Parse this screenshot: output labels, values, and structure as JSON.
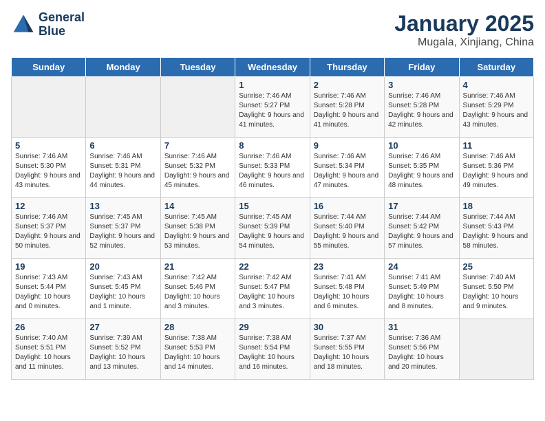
{
  "header": {
    "logo_line1": "General",
    "logo_line2": "Blue",
    "title": "January 2025",
    "subtitle": "Mugala, Xinjiang, China"
  },
  "weekdays": [
    "Sunday",
    "Monday",
    "Tuesday",
    "Wednesday",
    "Thursday",
    "Friday",
    "Saturday"
  ],
  "weeks": [
    [
      {
        "num": "",
        "info": ""
      },
      {
        "num": "",
        "info": ""
      },
      {
        "num": "",
        "info": ""
      },
      {
        "num": "1",
        "info": "Sunrise: 7:46 AM\nSunset: 5:27 PM\nDaylight: 9 hours and 41 minutes."
      },
      {
        "num": "2",
        "info": "Sunrise: 7:46 AM\nSunset: 5:28 PM\nDaylight: 9 hours and 41 minutes."
      },
      {
        "num": "3",
        "info": "Sunrise: 7:46 AM\nSunset: 5:28 PM\nDaylight: 9 hours and 42 minutes."
      },
      {
        "num": "4",
        "info": "Sunrise: 7:46 AM\nSunset: 5:29 PM\nDaylight: 9 hours and 43 minutes."
      }
    ],
    [
      {
        "num": "5",
        "info": "Sunrise: 7:46 AM\nSunset: 5:30 PM\nDaylight: 9 hours and 43 minutes."
      },
      {
        "num": "6",
        "info": "Sunrise: 7:46 AM\nSunset: 5:31 PM\nDaylight: 9 hours and 44 minutes."
      },
      {
        "num": "7",
        "info": "Sunrise: 7:46 AM\nSunset: 5:32 PM\nDaylight: 9 hours and 45 minutes."
      },
      {
        "num": "8",
        "info": "Sunrise: 7:46 AM\nSunset: 5:33 PM\nDaylight: 9 hours and 46 minutes."
      },
      {
        "num": "9",
        "info": "Sunrise: 7:46 AM\nSunset: 5:34 PM\nDaylight: 9 hours and 47 minutes."
      },
      {
        "num": "10",
        "info": "Sunrise: 7:46 AM\nSunset: 5:35 PM\nDaylight: 9 hours and 48 minutes."
      },
      {
        "num": "11",
        "info": "Sunrise: 7:46 AM\nSunset: 5:36 PM\nDaylight: 9 hours and 49 minutes."
      }
    ],
    [
      {
        "num": "12",
        "info": "Sunrise: 7:46 AM\nSunset: 5:37 PM\nDaylight: 9 hours and 50 minutes."
      },
      {
        "num": "13",
        "info": "Sunrise: 7:45 AM\nSunset: 5:37 PM\nDaylight: 9 hours and 52 minutes."
      },
      {
        "num": "14",
        "info": "Sunrise: 7:45 AM\nSunset: 5:38 PM\nDaylight: 9 hours and 53 minutes."
      },
      {
        "num": "15",
        "info": "Sunrise: 7:45 AM\nSunset: 5:39 PM\nDaylight: 9 hours and 54 minutes."
      },
      {
        "num": "16",
        "info": "Sunrise: 7:44 AM\nSunset: 5:40 PM\nDaylight: 9 hours and 55 minutes."
      },
      {
        "num": "17",
        "info": "Sunrise: 7:44 AM\nSunset: 5:42 PM\nDaylight: 9 hours and 57 minutes."
      },
      {
        "num": "18",
        "info": "Sunrise: 7:44 AM\nSunset: 5:43 PM\nDaylight: 9 hours and 58 minutes."
      }
    ],
    [
      {
        "num": "19",
        "info": "Sunrise: 7:43 AM\nSunset: 5:44 PM\nDaylight: 10 hours and 0 minutes."
      },
      {
        "num": "20",
        "info": "Sunrise: 7:43 AM\nSunset: 5:45 PM\nDaylight: 10 hours and 1 minute."
      },
      {
        "num": "21",
        "info": "Sunrise: 7:42 AM\nSunset: 5:46 PM\nDaylight: 10 hours and 3 minutes."
      },
      {
        "num": "22",
        "info": "Sunrise: 7:42 AM\nSunset: 5:47 PM\nDaylight: 10 hours and 3 minutes."
      },
      {
        "num": "23",
        "info": "Sunrise: 7:41 AM\nSunset: 5:48 PM\nDaylight: 10 hours and 6 minutes."
      },
      {
        "num": "24",
        "info": "Sunrise: 7:41 AM\nSunset: 5:49 PM\nDaylight: 10 hours and 8 minutes."
      },
      {
        "num": "25",
        "info": "Sunrise: 7:40 AM\nSunset: 5:50 PM\nDaylight: 10 hours and 9 minutes."
      }
    ],
    [
      {
        "num": "26",
        "info": "Sunrise: 7:40 AM\nSunset: 5:51 PM\nDaylight: 10 hours and 11 minutes."
      },
      {
        "num": "27",
        "info": "Sunrise: 7:39 AM\nSunset: 5:52 PM\nDaylight: 10 hours and 13 minutes."
      },
      {
        "num": "28",
        "info": "Sunrise: 7:38 AM\nSunset: 5:53 PM\nDaylight: 10 hours and 14 minutes."
      },
      {
        "num": "29",
        "info": "Sunrise: 7:38 AM\nSunset: 5:54 PM\nDaylight: 10 hours and 16 minutes."
      },
      {
        "num": "30",
        "info": "Sunrise: 7:37 AM\nSunset: 5:55 PM\nDaylight: 10 hours and 18 minutes."
      },
      {
        "num": "31",
        "info": "Sunrise: 7:36 AM\nSunset: 5:56 PM\nDaylight: 10 hours and 20 minutes."
      },
      {
        "num": "",
        "info": ""
      }
    ]
  ]
}
